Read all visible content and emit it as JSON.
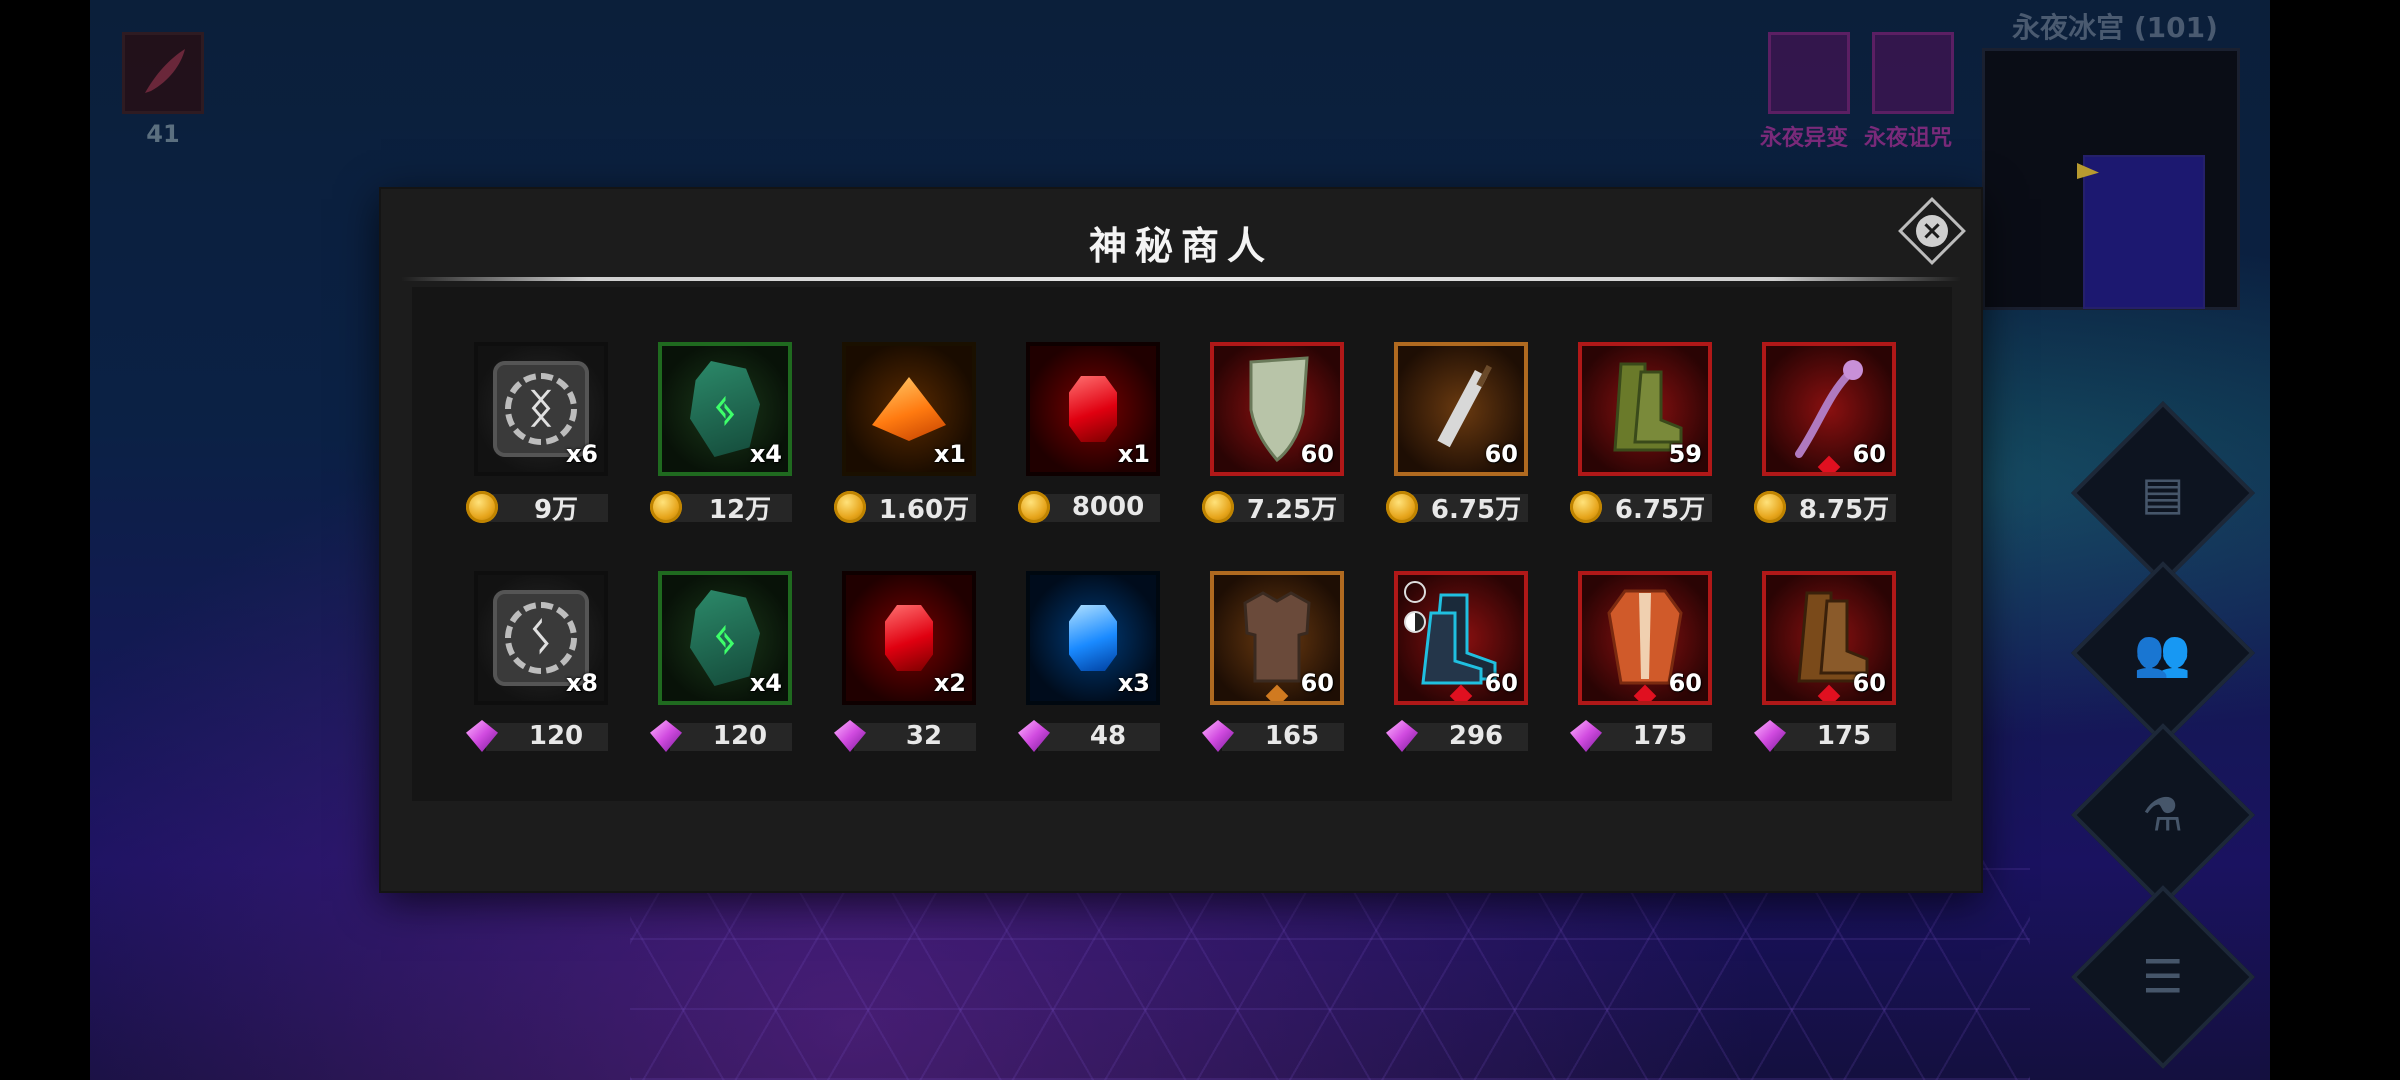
{
  "hud": {
    "quest_count": "41",
    "status_effects": [
      {
        "label": "永夜异变"
      },
      {
        "label": "永夜诅咒"
      }
    ],
    "zone_name": "永夜冰宫 (101)"
  },
  "dialog": {
    "title": "神秘商人",
    "close_icon": "close-icon"
  },
  "currency_icons": {
    "coin": "gold-coin-icon",
    "gem": "purple-gem-icon"
  },
  "shop": {
    "row1": [
      {
        "item": "gray-rune-stone",
        "count": "x6",
        "currency": "coin",
        "price": "9万"
      },
      {
        "item": "green-rune-stone",
        "count": "x4",
        "currency": "coin",
        "price": "12万"
      },
      {
        "item": "orange-gem",
        "count": "x1",
        "currency": "coin",
        "price": "1.60万"
      },
      {
        "item": "red-gem",
        "count": "x1",
        "currency": "coin",
        "price": "8000"
      },
      {
        "item": "shield",
        "count": "60",
        "currency": "coin",
        "price": "7.25万"
      },
      {
        "item": "greatsword",
        "count": "60",
        "currency": "coin",
        "price": "6.75万"
      },
      {
        "item": "green-boots",
        "count": "59",
        "currency": "coin",
        "price": "6.75万"
      },
      {
        "item": "purple-staff",
        "count": "60",
        "currency": "coin",
        "price": "8.75万"
      }
    ],
    "row2": [
      {
        "item": "gray-rune-stone",
        "count": "x8",
        "currency": "gem",
        "price": "120"
      },
      {
        "item": "green-rune-stone",
        "count": "x4",
        "currency": "gem",
        "price": "120"
      },
      {
        "item": "red-gem",
        "count": "x2",
        "currency": "gem",
        "price": "32"
      },
      {
        "item": "blue-gem",
        "count": "x3",
        "currency": "gem",
        "price": "48"
      },
      {
        "item": "chest-armor",
        "count": "60",
        "currency": "gem",
        "price": "165"
      },
      {
        "item": "cyber-boots",
        "count": "60",
        "currency": "gem",
        "price": "296"
      },
      {
        "item": "red-robe",
        "count": "60",
        "currency": "gem",
        "price": "175"
      },
      {
        "item": "brown-boots",
        "count": "60",
        "currency": "gem",
        "price": "175"
      }
    ]
  },
  "side_buttons": [
    {
      "icon": "quest-log-icon"
    },
    {
      "icon": "party-icon"
    },
    {
      "icon": "potion-icon"
    },
    {
      "icon": "menu-list-icon"
    }
  ]
}
